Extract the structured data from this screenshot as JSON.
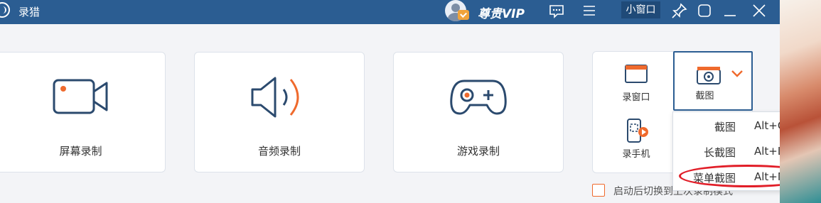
{
  "app": {
    "title": "录猎",
    "vip_label": "尊贵VIP",
    "mini_window_label": "小窗口"
  },
  "titlebar_icons": [
    "message-icon",
    "menu-icon",
    "pin-icon",
    "restore-icon",
    "minimize-icon",
    "close-icon"
  ],
  "cards": [
    {
      "label": "屏幕录制",
      "icon": "video-camera-icon"
    },
    {
      "label": "音频录制",
      "icon": "speaker-icon"
    },
    {
      "label": "游戏录制",
      "icon": "gamepad-icon"
    }
  ],
  "tools": {
    "record_window": "录窗口",
    "screenshot": "截图",
    "record_phone": "录手机"
  },
  "screenshot_menu": [
    {
      "name": "截图",
      "shortcut": "Alt+C"
    },
    {
      "name": "长截图",
      "shortcut": "Alt+L"
    },
    {
      "name": "菜单截图",
      "shortcut": "Alt+M"
    }
  ],
  "option_label": "启动后切换到上次录制模式",
  "colors": {
    "titlebar": "#2b5d92",
    "accent_orange": "#ef6a2d",
    "icon_navy": "#2b4a6e",
    "annotation_red": "#e11e28"
  }
}
